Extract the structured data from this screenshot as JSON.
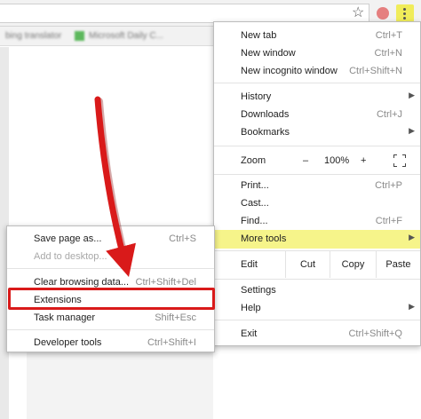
{
  "toolbar": {
    "omnibox_value": "",
    "star_icon": "star-icon",
    "extension_icon": "extension-icon",
    "menu_icon": "vertical-dots-icon"
  },
  "bookmarks": [
    "bing translator",
    "Microsoft Daily C..."
  ],
  "menu": {
    "new_tab": {
      "label": "New tab",
      "shortcut": "Ctrl+T"
    },
    "new_window": {
      "label": "New window",
      "shortcut": "Ctrl+N"
    },
    "new_incognito": {
      "label": "New incognito window",
      "shortcut": "Ctrl+Shift+N"
    },
    "history": {
      "label": "History"
    },
    "downloads": {
      "label": "Downloads",
      "shortcut": "Ctrl+J"
    },
    "bookmarks": {
      "label": "Bookmarks"
    },
    "zoom": {
      "label": "Zoom",
      "minus": "–",
      "value": "100%",
      "plus": "+"
    },
    "print": {
      "label": "Print...",
      "shortcut": "Ctrl+P"
    },
    "cast": {
      "label": "Cast..."
    },
    "find": {
      "label": "Find...",
      "shortcut": "Ctrl+F"
    },
    "more_tools": {
      "label": "More tools"
    },
    "edit": {
      "label": "Edit",
      "cut": "Cut",
      "copy": "Copy",
      "paste": "Paste"
    },
    "settings": {
      "label": "Settings"
    },
    "help": {
      "label": "Help"
    },
    "exit": {
      "label": "Exit",
      "shortcut": "Ctrl+Shift+Q"
    }
  },
  "submenu": {
    "save_page": {
      "label": "Save page as...",
      "shortcut": "Ctrl+S"
    },
    "add_desktop": {
      "label": "Add to desktop..."
    },
    "clear_browsing": {
      "label": "Clear browsing data...",
      "shortcut": "Ctrl+Shift+Del"
    },
    "extensions": {
      "label": "Extensions"
    },
    "task_manager": {
      "label": "Task manager",
      "shortcut": "Shift+Esc"
    },
    "developer_tools": {
      "label": "Developer tools",
      "shortcut": "Ctrl+Shift+I"
    }
  },
  "colors": {
    "highlight": "#f6f48a",
    "annotation_red": "#d91a1a"
  }
}
